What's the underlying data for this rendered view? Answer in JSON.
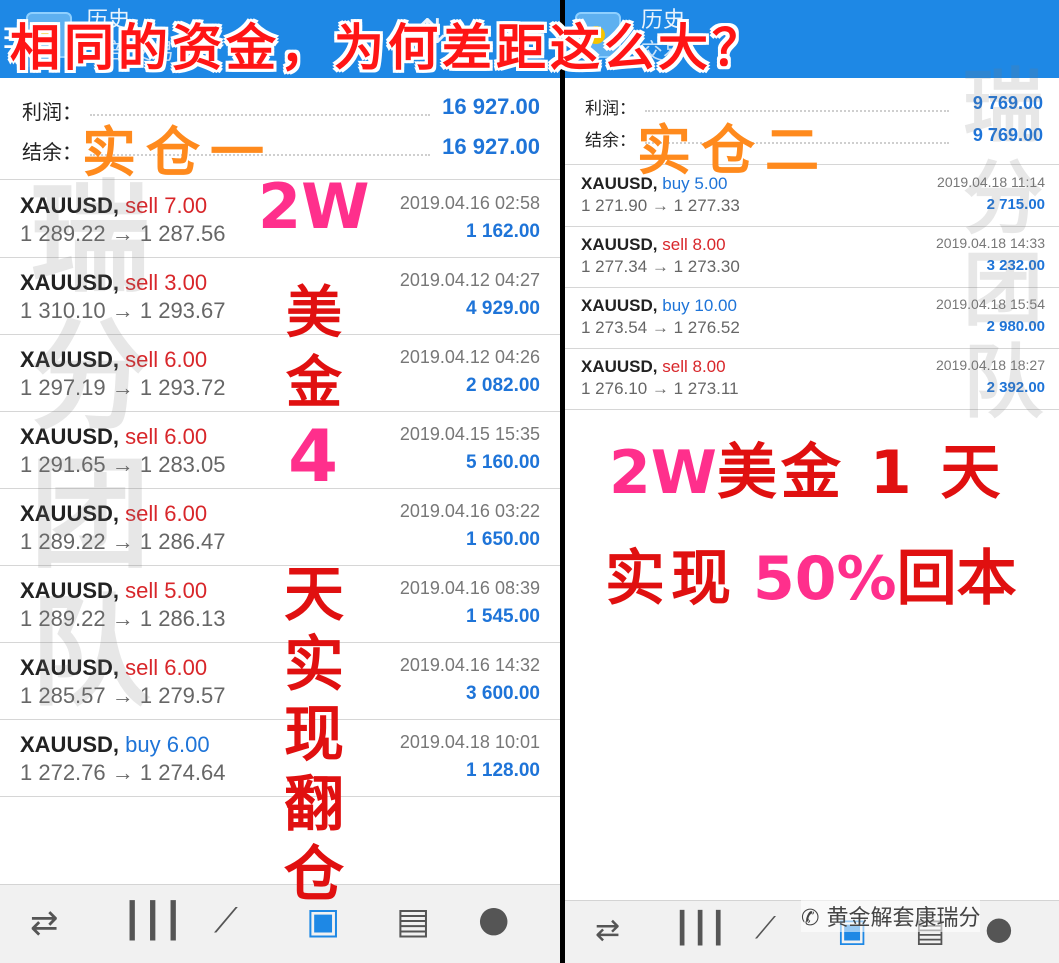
{
  "headline": "相同的资金，为何差距这么大？",
  "left": {
    "header": {
      "title": "历史",
      "subtitle": "全部交易"
    },
    "summary": {
      "profit_label": "利润：",
      "profit_value": "16 927.00",
      "balance_label": "结余：",
      "balance_value": "16 927.00"
    },
    "trades": [
      {
        "symbol": "XAUUSD,",
        "side": "sell",
        "volume": "7.00",
        "prices": "1 289.22 → 1 287.56",
        "date": "2019.04.16 02:58",
        "profit": "1 162.00"
      },
      {
        "symbol": "XAUUSD,",
        "side": "sell",
        "volume": "3.00",
        "prices": "1 310.10 → 1 293.67",
        "date": "2019.04.12 04:27",
        "profit": "4 929.00"
      },
      {
        "symbol": "XAUUSD,",
        "side": "sell",
        "volume": "6.00",
        "prices": "1 297.19 → 1 293.72",
        "date": "2019.04.12 04:26",
        "profit": "2 082.00"
      },
      {
        "symbol": "XAUUSD,",
        "side": "sell",
        "volume": "6.00",
        "prices": "1 291.65 → 1 283.05",
        "date": "2019.04.15 15:35",
        "profit": "5 160.00"
      },
      {
        "symbol": "XAUUSD,",
        "side": "sell",
        "volume": "6.00",
        "prices": "1 289.22 → 1 286.47",
        "date": "2019.04.16 03:22",
        "profit": "1 650.00"
      },
      {
        "symbol": "XAUUSD,",
        "side": "sell",
        "volume": "5.00",
        "prices": "1 289.22 → 1 286.13",
        "date": "2019.04.16 08:39",
        "profit": "1 545.00"
      },
      {
        "symbol": "XAUUSD,",
        "side": "sell",
        "volume": "6.00",
        "prices": "1 285.57 → 1 279.57",
        "date": "2019.04.16 14:32",
        "profit": "3 600.00"
      },
      {
        "symbol": "XAUUSD,",
        "side": "buy",
        "volume": "6.00",
        "prices": "1 272.76 → 1 274.64",
        "date": "2019.04.18 10:01",
        "profit": "1 128.00"
      }
    ],
    "overlay": {
      "account_label": "实仓一",
      "amount": "2W",
      "usd": [
        "美",
        "金"
      ],
      "days": "4",
      "result": [
        "天",
        "实",
        "现",
        "翻",
        "仓"
      ]
    },
    "watermark": [
      "瑞",
      "分",
      "团",
      "队"
    ]
  },
  "right": {
    "header": {
      "title": "历史",
      "subtitle": "交易"
    },
    "summary": {
      "profit_label": "利润：",
      "profit_value": "9 769.00",
      "balance_label": "结余：",
      "balance_value": "9 769.00"
    },
    "trades": [
      {
        "symbol": "XAUUSD,",
        "side": "buy",
        "volume": "5.00",
        "prices": "1 271.90 → 1 277.33",
        "date": "2019.04.18 11:14",
        "profit": "2 715.00"
      },
      {
        "symbol": "XAUUSD,",
        "side": "sell",
        "volume": "8.00",
        "prices": "1 277.34 → 1 273.30",
        "date": "2019.04.18 14:33",
        "profit": "3 232.00"
      },
      {
        "symbol": "XAUUSD,",
        "side": "buy",
        "volume": "10.00",
        "prices": "1 273.54 → 1 276.52",
        "date": "2019.04.18 15:54",
        "profit": "2 980.00"
      },
      {
        "symbol": "XAUUSD,",
        "side": "sell",
        "volume": "8.00",
        "prices": "1 276.10 → 1 273.11",
        "date": "2019.04.18 18:27",
        "profit": "2 392.00"
      }
    ],
    "overlay": {
      "account_label": "实仓二",
      "line1_pink": "2W",
      "line1_red": "美金 1 天",
      "line2_red_a": "实现",
      "line2_pink": "50%",
      "line2_red_b": "回本"
    },
    "watermark": [
      "瑞",
      "分",
      "团",
      "队"
    ],
    "wechat_label": "黄金解套康瑞分"
  },
  "nav_icons": [
    "quotes-icon",
    "chart-icon",
    "trade-icon",
    "history-icon",
    "news-icon",
    "chat-icon"
  ],
  "colors": {
    "accent": "#1e88e5",
    "sell": "#d8262a",
    "buy": "#1e74d8",
    "headline": "#ff1515",
    "orange": "#ff8a1d",
    "pink": "#ff2f8c"
  }
}
